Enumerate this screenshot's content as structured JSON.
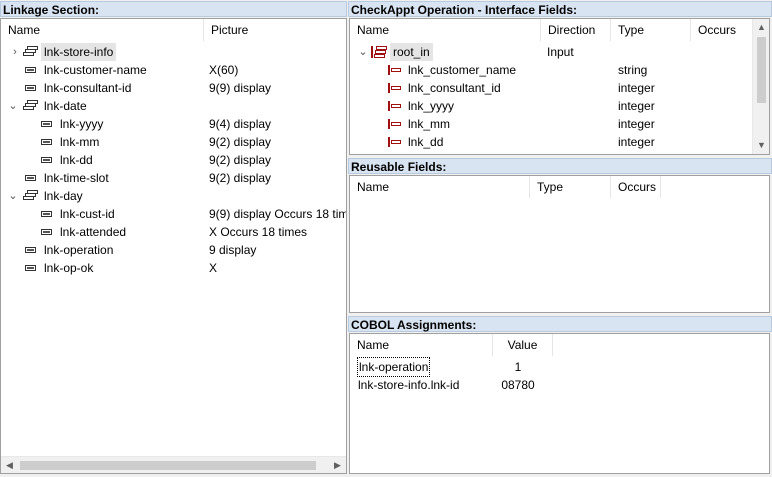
{
  "linkage": {
    "title": "Linkage Section:",
    "columns": [
      "Name",
      "Picture"
    ],
    "rows": [
      {
        "name": "lnk-store-info",
        "picture": ""
      },
      {
        "name": "lnk-customer-name",
        "picture": "X(60)"
      },
      {
        "name": "lnk-consultant-id",
        "picture": "9(9) display"
      },
      {
        "name": "lnk-date",
        "picture": ""
      },
      {
        "name": "lnk-yyyy",
        "picture": "9(4) display"
      },
      {
        "name": "lnk-mm",
        "picture": "9(2) display"
      },
      {
        "name": "lnk-dd",
        "picture": "9(2) display"
      },
      {
        "name": "lnk-time-slot",
        "picture": "9(2) display"
      },
      {
        "name": "lnk-day",
        "picture": ""
      },
      {
        "name": "lnk-cust-id",
        "picture": "9(9) display Occurs 18 tim"
      },
      {
        "name": "lnk-attended",
        "picture": "X Occurs 18 times"
      },
      {
        "name": "lnk-operation",
        "picture": "9 display"
      },
      {
        "name": "lnk-op-ok",
        "picture": "X"
      }
    ]
  },
  "interface": {
    "title": "CheckAppt Operation - Interface Fields:",
    "columns": [
      "Name",
      "Direction",
      "Type",
      "Occurs"
    ],
    "rows": [
      {
        "name": "root_in",
        "direction": "Input",
        "type": "",
        "occurs": ""
      },
      {
        "name": "lnk_customer_name",
        "direction": "",
        "type": "string",
        "occurs": ""
      },
      {
        "name": "lnk_consultant_id",
        "direction": "",
        "type": "integer",
        "occurs": ""
      },
      {
        "name": "lnk_yyyy",
        "direction": "",
        "type": "integer",
        "occurs": ""
      },
      {
        "name": "lnk_mm",
        "direction": "",
        "type": "integer",
        "occurs": ""
      },
      {
        "name": "lnk_dd",
        "direction": "",
        "type": "integer",
        "occurs": ""
      }
    ]
  },
  "reusable": {
    "title": "Reusable Fields:",
    "columns": [
      "Name",
      "Type",
      "Occurs"
    ]
  },
  "cobol": {
    "title": "COBOL Assignments:",
    "columns": [
      "Name",
      "Value"
    ],
    "rows": [
      {
        "name": "lnk-operation",
        "value": "1"
      },
      {
        "name": "lnk-store-info.lnk-id",
        "value": "08780"
      }
    ]
  },
  "icons": {
    "expand": "chevron-right-icon",
    "collapse": "chevron-down-icon",
    "group": "group-record-icon",
    "leaf": "field-icon",
    "interface_field": "interface-field-icon",
    "scroll_up": "scroll-up-arrow-icon",
    "scroll_down": "scroll-down-arrow-icon",
    "scroll_left": "scroll-left-arrow-icon",
    "scroll_right": "scroll-right-arrow-icon"
  },
  "colors": {
    "header_bg": "#d9e4f2",
    "field_icon": "#a01010",
    "selection": "#e5e5e5"
  }
}
